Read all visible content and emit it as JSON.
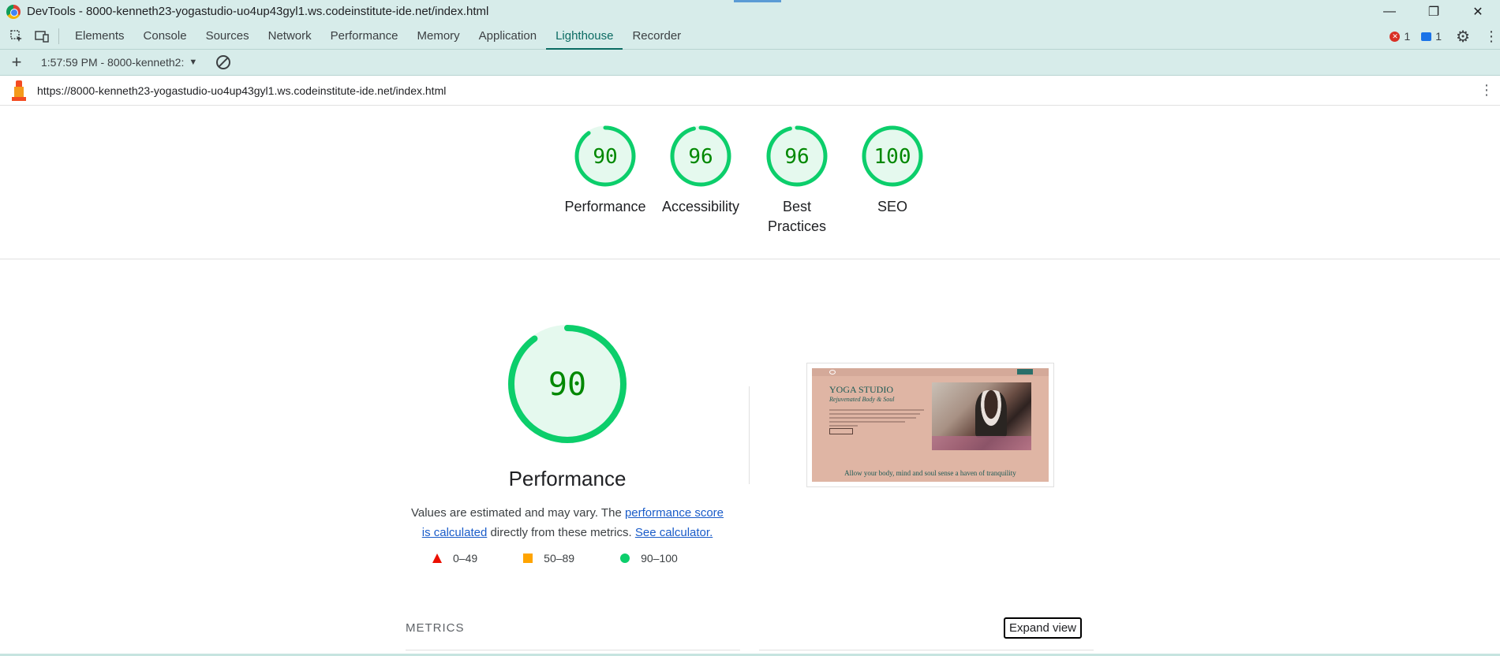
{
  "window": {
    "title": "DevTools - 8000-kenneth23-yogastudio-uo4up43gyl1.ws.codeinstitute-ide.net/index.html",
    "minimize": "—",
    "restore": "❐",
    "close": "✕"
  },
  "devtools": {
    "tabs": [
      {
        "label": "Elements"
      },
      {
        "label": "Console"
      },
      {
        "label": "Sources"
      },
      {
        "label": "Network"
      },
      {
        "label": "Performance"
      },
      {
        "label": "Memory"
      },
      {
        "label": "Application"
      },
      {
        "label": "Lighthouse"
      },
      {
        "label": "Recorder"
      }
    ],
    "active_tab": "Lighthouse",
    "error_count": "1",
    "message_count": "1"
  },
  "lighthouse": {
    "add_label": "+",
    "report_select": "1:57:59 PM - 8000-kenneth2:",
    "url": "https://8000-kenneth23-yogastudio-uo4up43gyl1.ws.codeinstitute-ide.net/index.html",
    "scores": [
      {
        "value": 90,
        "label": "Performance"
      },
      {
        "value": 96,
        "label": "Accessibility"
      },
      {
        "value": 96,
        "label": "Best Practices"
      },
      {
        "value": 100,
        "label": "SEO"
      }
    ],
    "performance": {
      "score": 90,
      "title": "Performance",
      "desc_pre": "Values are estimated and may vary. The ",
      "desc_link1": "performance score is calculated",
      "desc_mid": " directly from these metrics. ",
      "desc_link2": "See calculator.",
      "legend": [
        {
          "range": "0–49"
        },
        {
          "range": "50–89"
        },
        {
          "range": "90–100"
        }
      ]
    },
    "screenshot": {
      "heading": "YOGA STUDIO",
      "subheading": "Rejuvenated Body & Soul",
      "tagline": "Allow your body, mind and soul sense a haven of tranquility"
    },
    "metrics_title": "METRICS",
    "expand_label": "Expand view"
  },
  "colors": {
    "pass": "#0cce6b",
    "pass_fill": "#e5f9ee",
    "pass_text": "#008800",
    "average": "#ffa400",
    "fail": "#eb0f00",
    "chrome_bg": "#d7ecea",
    "active_tab": "#0b6b62"
  }
}
